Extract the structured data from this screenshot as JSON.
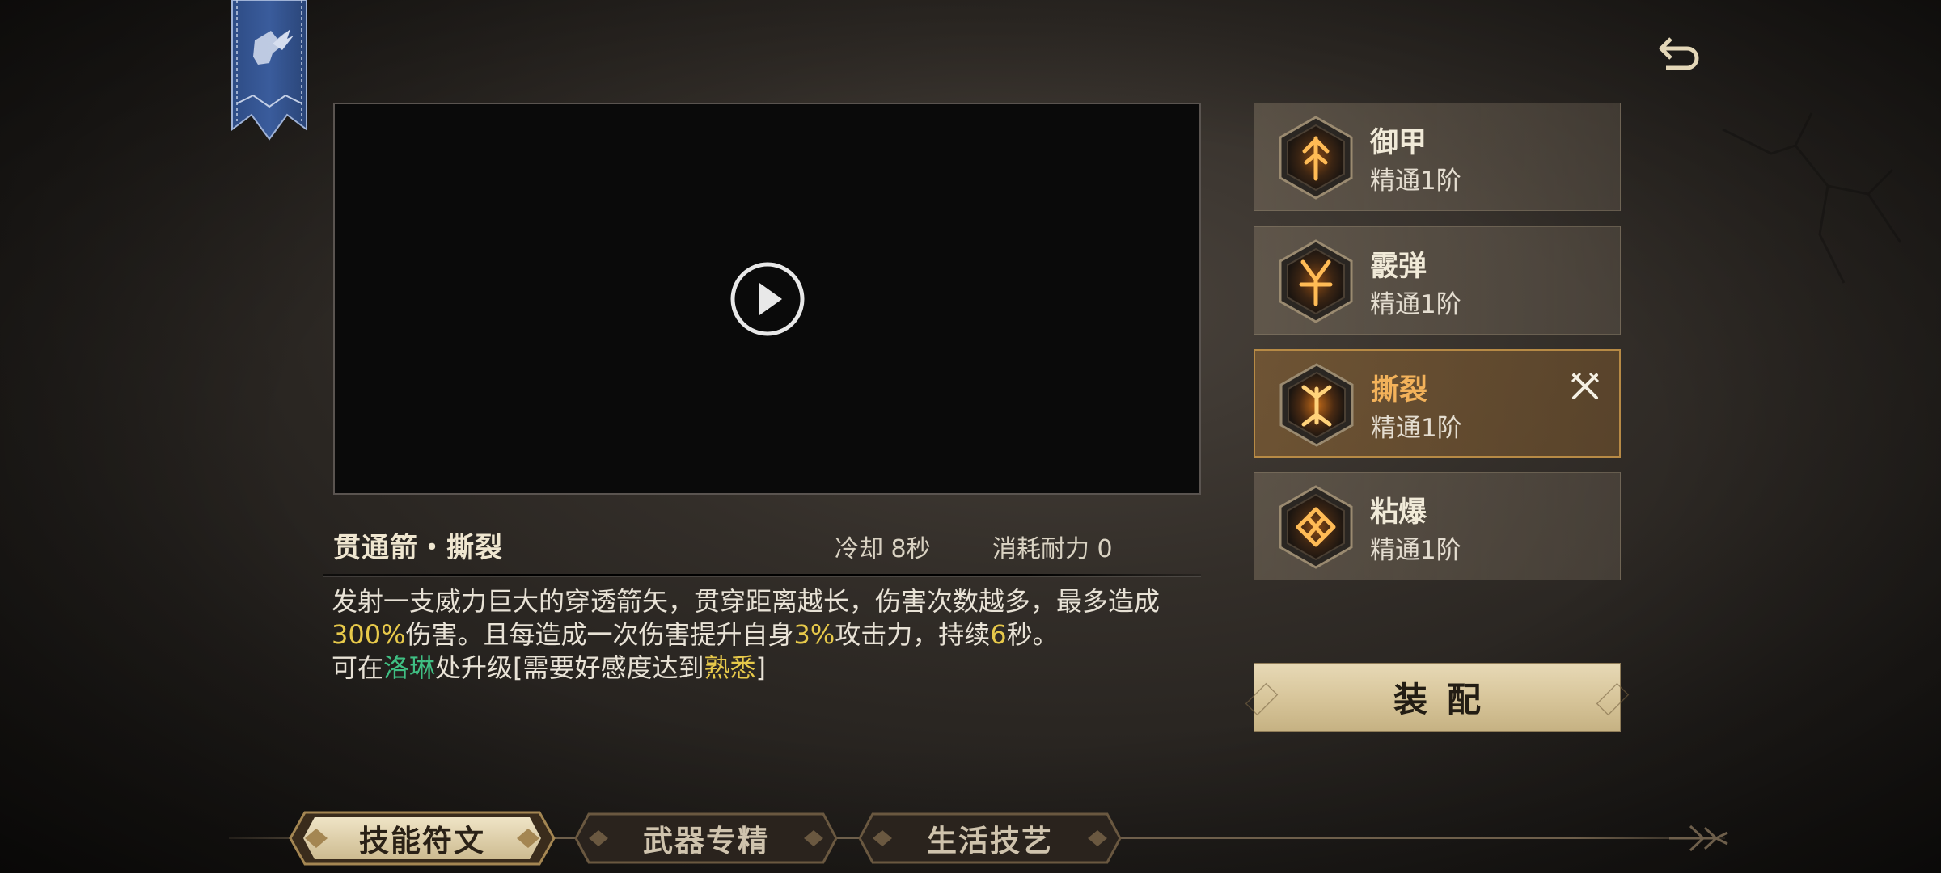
{
  "nav": {
    "banner_icon": "winged-boot-emblem",
    "back_icon": "return-arrow-icon"
  },
  "video": {
    "play_icon": "play-icon"
  },
  "skill": {
    "name": "贯通箭・撕裂",
    "cooldown": "冷却 8秒",
    "stamina": "消耗耐力 0",
    "desc_p1": "发射一支威力巨大的穿透箭矢，贯穿距离越长，伤害次数越多，最多造成",
    "desc_v1": "300%",
    "desc_p2": "伤害。且每造成一次伤害提升自身",
    "desc_v2": "3%",
    "desc_p3": "攻击力，持续",
    "desc_v3": "6",
    "desc_p4": "秒。",
    "upgrade_p1": "可在",
    "upgrade_npc": "洛琳",
    "upgrade_p2": "处升级[需要好感度达到",
    "upgrade_req": "熟悉",
    "upgrade_p3": "]"
  },
  "runes": [
    {
      "title": "御甲",
      "level": "精通1阶",
      "icon": "rune-armor-icon"
    },
    {
      "title": "霰弹",
      "level": "精通1阶",
      "icon": "rune-scatter-icon"
    },
    {
      "title": "撕裂",
      "level": "精通1阶",
      "icon": "rune-tear-icon",
      "selected": true,
      "equipped_icon": "crossed-swords-icon"
    },
    {
      "title": "粘爆",
      "level": "精通1阶",
      "icon": "rune-sticky-bomb-icon"
    }
  ],
  "equip": {
    "label": "装配"
  },
  "tabs": [
    {
      "label": "技能符文",
      "active": true
    },
    {
      "label": "武器专精",
      "active": false
    },
    {
      "label": "生活技艺",
      "active": false
    }
  ],
  "colors": {
    "highlight_yellow": "#e7c94a",
    "highlight_green": "#3fbf83",
    "selected_title": "#f3b25a",
    "rune_glow": "#f29a2c"
  }
}
